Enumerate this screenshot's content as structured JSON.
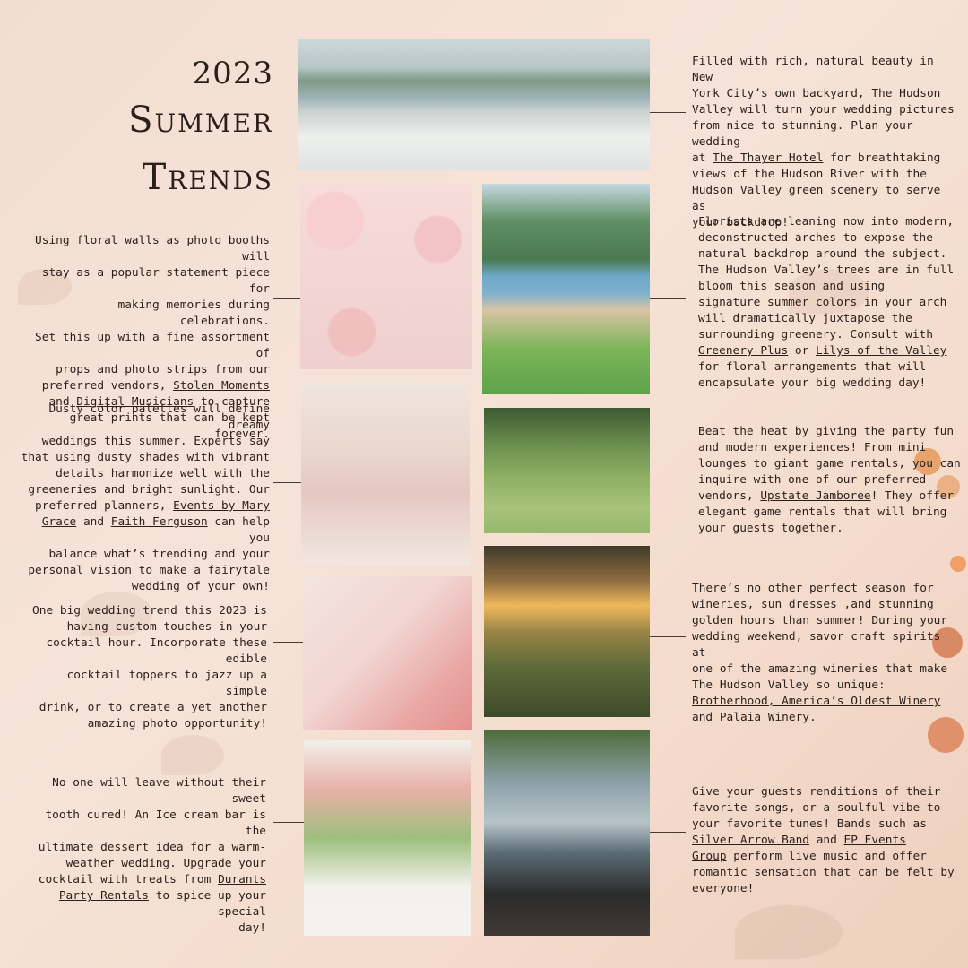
{
  "title": {
    "year": "2023",
    "line1": "Summer",
    "line2": "Trends"
  },
  "left_texts": [
    {
      "id": "floral",
      "parts": [
        {
          "t": "Using floral walls as photo booths will\nstay as a popular statement piece for\nmaking memories during celebrations.\nSet this up with a fine assortment of\nprops and photo strips from our\npreferred vendors, "
        },
        {
          "t": "Stolen Moments",
          "link": true
        },
        {
          "t": "\nand "
        },
        {
          "t": "Digital Musicians",
          "link": true
        },
        {
          "t": " to capture\ngreat prints that can be kept forever."
        }
      ]
    },
    {
      "id": "dusty",
      "parts": [
        {
          "t": "Dusty color palettes will define dreamy\nweddings this summer. Experts say\nthat using dusty shades with vibrant\ndetails harmonize well with the\ngreeneries and bright sunlight. Our\npreferred planners, "
        },
        {
          "t": "Events by Mary\nGrace",
          "link": true
        },
        {
          "t": " and "
        },
        {
          "t": "Faith Ferguson",
          "link": true
        },
        {
          "t": " can help you\nbalance what’s trending and your\npersonal vision to make a fairytale\nwedding of your own!"
        }
      ]
    },
    {
      "id": "cocktail",
      "parts": [
        {
          "t": "One big wedding trend this 2023 is\nhaving custom touches in your\ncocktail hour. Incorporate these edible\ncocktail toppers to jazz up a simple\ndrink, or to create a yet another\namazing photo opportunity!"
        }
      ]
    },
    {
      "id": "icecream",
      "parts": [
        {
          "t": "No one will leave without their sweet\ntooth cured! An Ice cream bar is the\nultimate dessert idea for a warm-\nweather wedding. Upgrade your\ncocktail with treats from "
        },
        {
          "t": "Durants\nParty Rentals",
          "link": true
        },
        {
          "t": " to spice up your special\nday!"
        }
      ]
    }
  ],
  "right_texts": [
    {
      "id": "hudson",
      "parts": [
        {
          "t": "Filled with rich, natural beauty in New\nYork City’s own backyard, The Hudson\nValley will turn your wedding pictures\nfrom nice to stunning. Plan your wedding\nat "
        },
        {
          "t": "The Thayer Hotel",
          "link": true
        },
        {
          "t": " for breathtaking\nviews of the Hudson River with the\nHudson Valley green scenery to serve as\nyour backdrop!"
        }
      ]
    },
    {
      "id": "arches",
      "parts": [
        {
          "t": "Florists are leaning now into modern,\ndeconstructed arches to expose the\nnatural backdrop around the subject.\nThe Hudson Valley’s trees are in full\nbloom this season and using\nsignature summer colors in your arch\nwill dramatically juxtapose the\nsurrounding greenery. Consult with\n"
        },
        {
          "t": "Greenery Plus",
          "link": true
        },
        {
          "t": " or "
        },
        {
          "t": "Lilys of the Valley",
          "link": true
        },
        {
          "t": "\nfor floral arrangements that will\nencapsulate your big wedding day!"
        }
      ]
    },
    {
      "id": "games",
      "parts": [
        {
          "t": "Beat the heat by giving the party fun\nand modern experiences! From mini\nlounges to giant game rentals, you can\ninquire with one of our preferred\nvendors, "
        },
        {
          "t": "Upstate Jamboree",
          "link": true
        },
        {
          "t": "! They offer\nelegant game rentals that will bring\nyour guests together."
        }
      ]
    },
    {
      "id": "wineries",
      "parts": [
        {
          "t": "There’s no other perfect season for\nwineries, sun dresses ,and stunning\ngolden hours than summer! During your\nwedding weekend, savor craft spirits at\none of the amazing wineries that make\nThe Hudson Valley so unique:\n"
        },
        {
          "t": "Brotherhood, America’s Oldest Winery",
          "link": true
        },
        {
          "t": "\nand "
        },
        {
          "t": "Palaia Winery",
          "link": true
        },
        {
          "t": "."
        }
      ]
    },
    {
      "id": "band",
      "parts": [
        {
          "t": "Give your guests renditions of their\nfavorite songs, or a soulful vibe to\nyour favorite tunes! Bands such as\n"
        },
        {
          "t": "Silver Arrow Band",
          "link": true
        },
        {
          "t": " and "
        },
        {
          "t": "EP Events\nGroup",
          "link": true
        },
        {
          "t": " perform live music and offer\nromantic sensation that can be felt by\neveryone!"
        }
      ]
    }
  ],
  "photos": [
    {
      "id": "hudson",
      "label": "Hudson River ceremony arch photo"
    },
    {
      "id": "booth",
      "label": "Couple kissing at floral wall"
    },
    {
      "id": "arch",
      "label": "Deconstructed floral arch by lake"
    },
    {
      "id": "table",
      "label": "Dusty palette table florals"
    },
    {
      "id": "games",
      "label": "Couple playing giant game"
    },
    {
      "id": "cocktail",
      "label": "Bride cocktail toppers"
    },
    {
      "id": "wine",
      "label": "Wine toast at golden hour"
    },
    {
      "id": "icecream",
      "label": "Ice cream bar with balloons"
    },
    {
      "id": "band",
      "label": "Live band by the lake"
    }
  ],
  "colors": {
    "background": "#f4dfd3",
    "text": "#2b1f1a",
    "accent_flowers": "#e39a63"
  }
}
